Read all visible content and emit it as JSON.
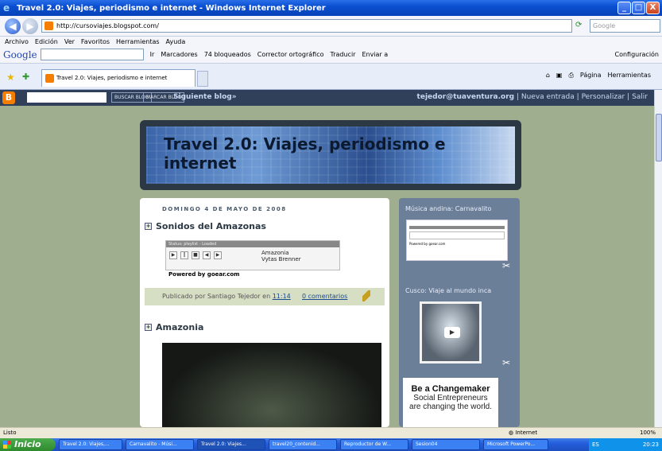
{
  "window": {
    "title": "Travel 2.0: Viajes, periodismo e internet - Windows Internet Explorer",
    "min": "_",
    "max": "□",
    "close": "X"
  },
  "address": {
    "url": "http://cursoviajes.blogspot.com/",
    "search_placeholder": "Google"
  },
  "menu": [
    "Archivo",
    "Edición",
    "Ver",
    "Favoritos",
    "Herramientas",
    "Ayuda"
  ],
  "gtoolbar": {
    "logo": "Google",
    "ir": "Ir",
    "marcadores": "Marcadores",
    "bloqueados": "74 bloqueados",
    "corrector": "Corrector ortográfico",
    "traducir": "Traducir",
    "enviar": "Enviar a",
    "config": "Configuración"
  },
  "tab": {
    "label": "Travel 2.0: Viajes, periodismo e internet"
  },
  "commands": {
    "pagina": "Página",
    "herramientas": "Herramientas"
  },
  "navbar": {
    "buscar": "BUSCAR BLOG",
    "marcar": "MARCAR BLOG",
    "siguiente": "Siguiente blog»",
    "user": "tejedor@tuaventura.org",
    "nueva": "Nueva entrada",
    "personalizar": "Personalizar",
    "salir": "Salir",
    "sep": "|"
  },
  "blog": {
    "title": "Travel 2.0: Viajes, periodismo e internet",
    "date": "DOMINGO 4 DE MAYO DE 2008",
    "post1": {
      "title": "Sonidos del Amazonas",
      "status": "Status: playlist - Loaded",
      "track": "Amazonia",
      "artist": "Vytas Brenner",
      "powered": "Powered by goear.com",
      "published": "Publicado por Santiago Tejedor",
      "en": "en",
      "time": "11:14",
      "comments": "0 comentarios"
    },
    "post2": {
      "title": "Amazonia"
    }
  },
  "sidebar": {
    "w1_title": "Música andina: Carnavalito",
    "w1_powered": "Powered by goear.com",
    "w2_title": "Cusco: Viaje al mundo inca",
    "ad_title": "Be a Changemaker",
    "ad_line1": "Social Entrepreneurs",
    "ad_line2": "are changing the world."
  },
  "status": {
    "text": "Listo",
    "zone": "Internet",
    "zoom": "100%"
  },
  "taskbar": {
    "start": "Inicio",
    "items": [
      "Travel 2.0: Viajes,...",
      "Carnavalito - Músi...",
      "Travel 2.0: Viajes...",
      "travel20_contenid...",
      "Reproductor de W...",
      "Sesion04",
      "Microsoft PowerPo..."
    ],
    "lang": "ES",
    "clock": "20:23"
  }
}
